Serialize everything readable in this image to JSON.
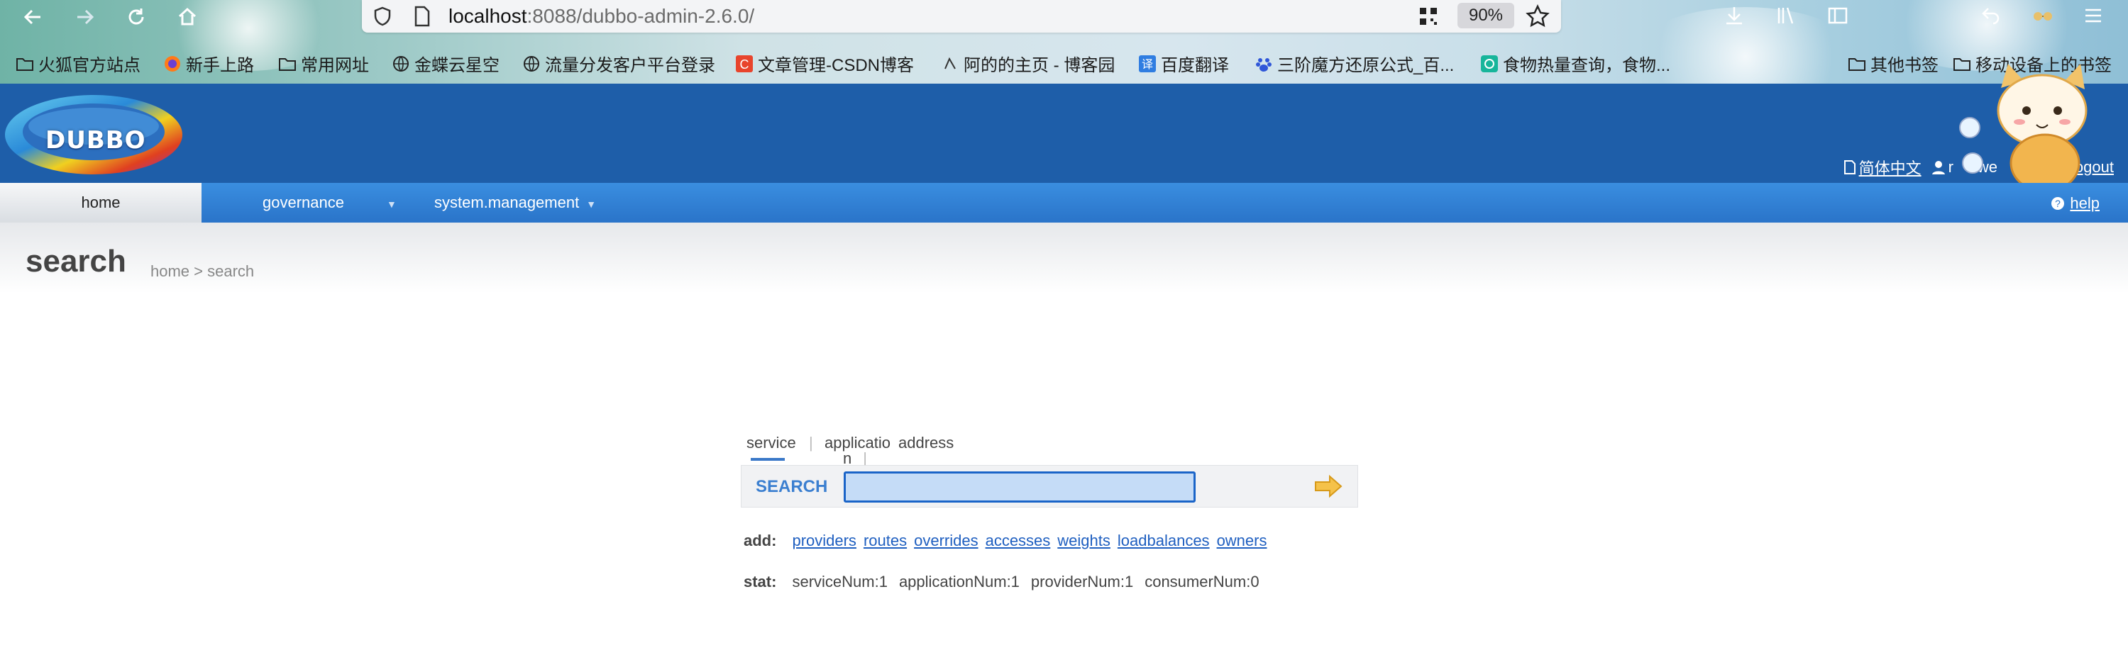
{
  "browser": {
    "url_host": "localhost",
    "url_rest": ":8088/dubbo-admin-2.6.0/",
    "zoom": "90%",
    "bookmarks": [
      {
        "label": "火狐官方站点",
        "icon": "folder-icon"
      },
      {
        "label": "新手上路",
        "icon": "firefox-icon"
      },
      {
        "label": "常用网址",
        "icon": "folder-icon"
      },
      {
        "label": "金蝶云星空",
        "icon": "globe-icon"
      },
      {
        "label": "流量分发客户平台登录",
        "icon": "globe-icon"
      },
      {
        "label": "文章管理-CSDN博客",
        "icon": "csdn-icon"
      },
      {
        "label": "阿的的主页 - 博客园",
        "icon": "cnblogs-icon"
      },
      {
        "label": "百度翻译",
        "icon": "translate-icon"
      },
      {
        "label": "三阶魔方还原公式_百...",
        "icon": "baidu-icon"
      },
      {
        "label": "食物热量查询，食物...",
        "icon": "food-icon"
      },
      {
        "label": "其他书签",
        "icon": "folder-icon"
      },
      {
        "label": "移动设备上的书签",
        "icon": "folder-icon"
      }
    ]
  },
  "header": {
    "logo_text": "DUBBO",
    "lang_link": "简体中文",
    "user_prefix": "r",
    "welcome": "we",
    "logout": "logout"
  },
  "menu": {
    "home": "home",
    "governance": "governance",
    "system": "system.management",
    "help": "help"
  },
  "page": {
    "title": "search",
    "breadcrumb": "home > search"
  },
  "search": {
    "tabs": {
      "service": "service",
      "application_top": "applicatio",
      "application_bottom": "n",
      "address": "address"
    },
    "label": "SEARCH",
    "input_value": ""
  },
  "add": {
    "label": "add:",
    "links": [
      "providers",
      "routes",
      "overrides",
      "accesses",
      "weights",
      "loadbalances",
      "owners"
    ]
  },
  "stat": {
    "label": "stat:",
    "items": [
      "serviceNum:1",
      "applicationNum:1",
      "providerNum:1",
      "consumerNum:0"
    ]
  },
  "colors": {
    "header_blue": "#1e5ea9",
    "menu_blue": "#3a8ee0",
    "link_blue": "#1f5fc0",
    "search_label": "#3b7fd0"
  }
}
